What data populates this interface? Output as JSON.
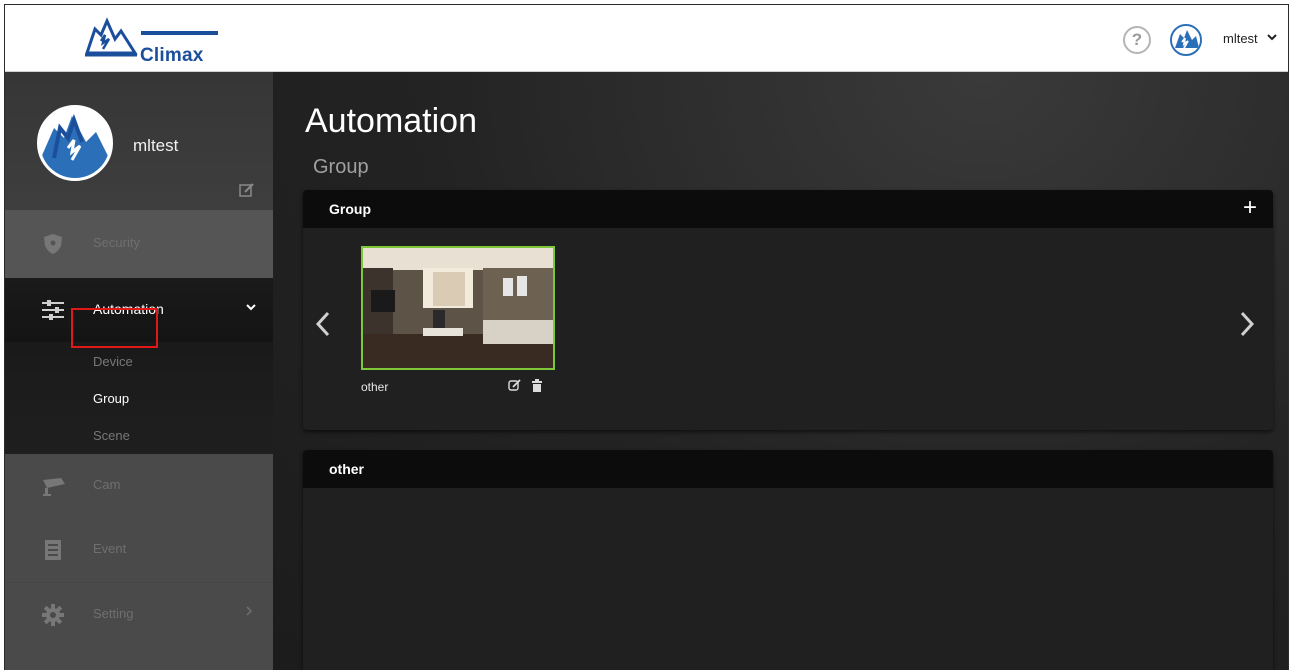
{
  "brand": {
    "name": "Climax"
  },
  "header": {
    "help_label": "?",
    "username": "mltest",
    "caret": "⌄"
  },
  "sidebar": {
    "profile": {
      "name": "mltest"
    },
    "items": [
      {
        "label": "Security",
        "icon": "shield-icon"
      },
      {
        "label": "Automation",
        "icon": "sliders-icon",
        "arrow": "⌄",
        "expanded": true,
        "children": [
          {
            "label": "Device"
          },
          {
            "label": "Group",
            "selected": true
          },
          {
            "label": "Scene"
          }
        ]
      },
      {
        "label": "Cam",
        "icon": "camera-icon"
      },
      {
        "label": "Event",
        "icon": "list-icon"
      },
      {
        "label": "Setting",
        "icon": "gear-icon",
        "arrow": "›"
      }
    ]
  },
  "main": {
    "title": "Automation",
    "subtitle": "Group",
    "group_panel": {
      "title": "Group",
      "add_label": "+",
      "prev_label": "‹",
      "next_label": "›",
      "cards": [
        {
          "label": "other"
        }
      ]
    },
    "other_panel": {
      "title": "other"
    }
  },
  "colors": {
    "accent_green": "#7cc83a",
    "highlight_red": "#e01818",
    "brand_blue": "#1b4f9c"
  }
}
